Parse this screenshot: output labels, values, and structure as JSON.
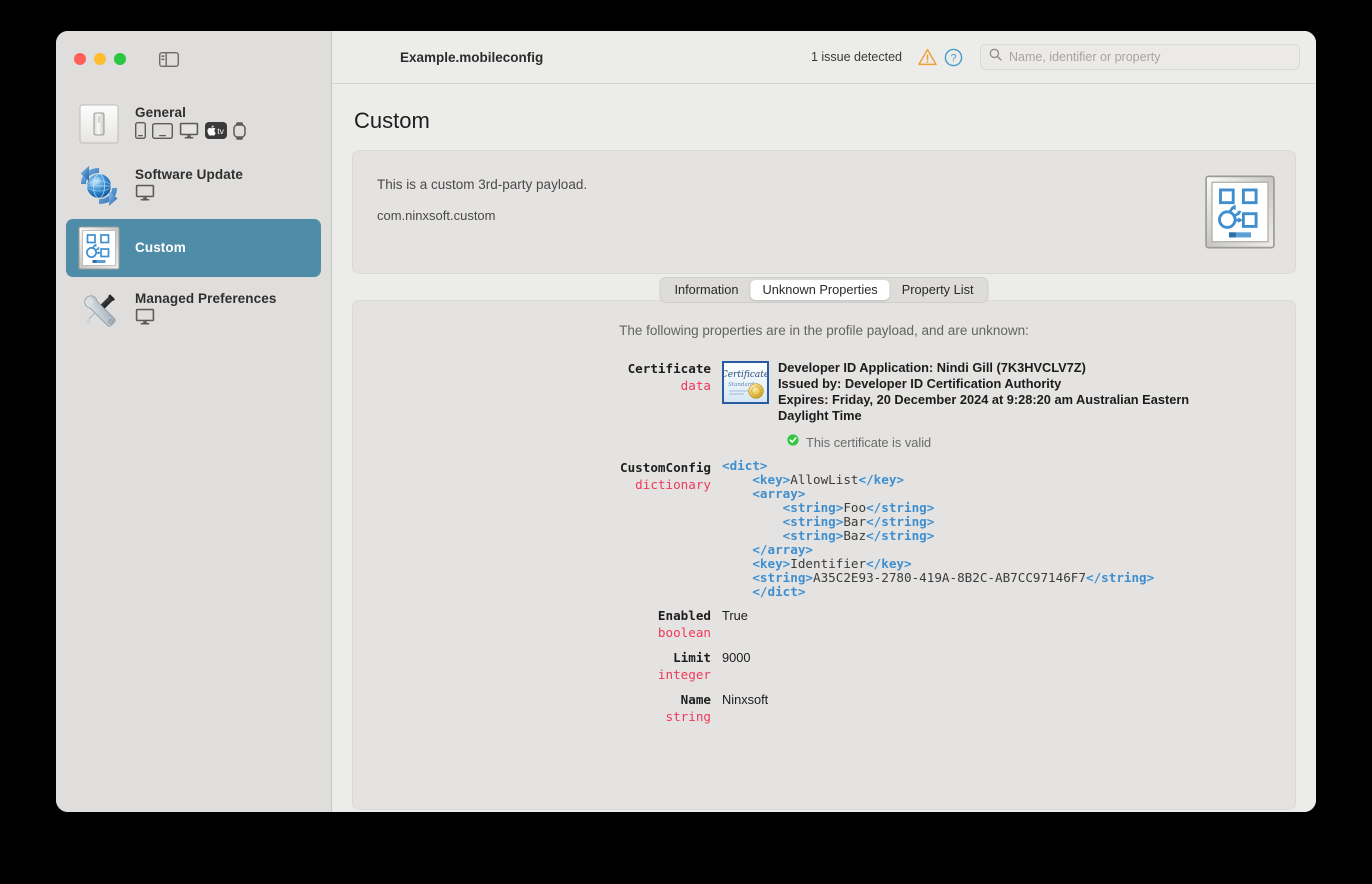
{
  "window": {
    "traffic_lights": [
      "close",
      "minimize",
      "zoom"
    ],
    "sidebar_toggle_icon": "sidebar-toggle-icon"
  },
  "toolbar": {
    "document_title": "Example.mobileconfig",
    "issue_text": "1 issue detected",
    "warning_icon": "warning-triangle-icon",
    "help_icon": "help-circle-icon",
    "search": {
      "icon": "search-icon",
      "placeholder": "Name, identifier or property",
      "value": ""
    }
  },
  "sidebar": {
    "items": [
      {
        "label": "General",
        "icon": "general-switch-icon",
        "platforms": [
          "iphone",
          "ipad",
          "mac",
          "appletv",
          "applewatch"
        ],
        "selected": false
      },
      {
        "label": "Software Update",
        "icon": "software-update-icon",
        "platforms": [
          "mac"
        ],
        "selected": false
      },
      {
        "label": "Custom",
        "icon": "custom-payload-icon",
        "platforms": [],
        "selected": true
      },
      {
        "label": "Managed Preferences",
        "icon": "managed-preferences-icon",
        "platforms": [
          "mac"
        ],
        "selected": false
      }
    ]
  },
  "page": {
    "title": "Custom",
    "description_line1": "This is a custom 3rd-party payload.",
    "description_line2": "com.ninxsoft.custom",
    "description_icon": "custom-payload-icon"
  },
  "tabs": [
    {
      "label": "Information",
      "active": false
    },
    {
      "label": "Unknown Properties",
      "active": true
    },
    {
      "label": "Property List",
      "active": false
    }
  ],
  "unknown_properties": {
    "intro": "The following properties are in the profile payload, and are unknown:",
    "rows": [
      {
        "key": "Certificate",
        "type": "data",
        "kind": "certificate",
        "thumb_icon": "certificate-icon",
        "subject": "Developer ID Application: Nindi Gill (7K3HVCLV7Z)",
        "issuer": "Issued by: Developer ID Certification Authority",
        "expires": "Expires: Friday, 20 December 2024 at 9:28:20 am Australian Eastern Daylight Time",
        "validity_icon": "valid-check-icon",
        "validity_text": "This certificate is valid"
      },
      {
        "key": "CustomConfig",
        "type": "dictionary",
        "kind": "xml",
        "xml_lines": [
          [
            {
              "t": "tag",
              "s": "<dict>"
            }
          ],
          [
            {
              "t": "pt",
              "s": "    "
            },
            {
              "t": "tag",
              "s": "<key>"
            },
            {
              "t": "pt",
              "s": "AllowList"
            },
            {
              "t": "tag",
              "s": "</key>"
            }
          ],
          [
            {
              "t": "pt",
              "s": "    "
            },
            {
              "t": "tag",
              "s": "<array>"
            }
          ],
          [
            {
              "t": "pt",
              "s": "        "
            },
            {
              "t": "tag",
              "s": "<string>"
            },
            {
              "t": "pt",
              "s": "Foo"
            },
            {
              "t": "tag",
              "s": "</string>"
            }
          ],
          [
            {
              "t": "pt",
              "s": "        "
            },
            {
              "t": "tag",
              "s": "<string>"
            },
            {
              "t": "pt",
              "s": "Bar"
            },
            {
              "t": "tag",
              "s": "</string>"
            }
          ],
          [
            {
              "t": "pt",
              "s": "        "
            },
            {
              "t": "tag",
              "s": "<string>"
            },
            {
              "t": "pt",
              "s": "Baz"
            },
            {
              "t": "tag",
              "s": "</string>"
            }
          ],
          [
            {
              "t": "pt",
              "s": "    "
            },
            {
              "t": "tag",
              "s": "</array>"
            }
          ],
          [
            {
              "t": "pt",
              "s": "    "
            },
            {
              "t": "tag",
              "s": "<key>"
            },
            {
              "t": "pt",
              "s": "Identifier"
            },
            {
              "t": "tag",
              "s": "</key>"
            }
          ],
          [
            {
              "t": "pt",
              "s": "    "
            },
            {
              "t": "tag",
              "s": "<string>"
            },
            {
              "t": "pt",
              "s": "A35C2E93-2780-419A-8B2C-AB7CC97146F7"
            },
            {
              "t": "tag",
              "s": "</string>"
            }
          ],
          [
            {
              "t": "pt",
              "s": "    "
            },
            {
              "t": "tag",
              "s": "</dict>"
            }
          ]
        ]
      },
      {
        "key": "Enabled",
        "type": "boolean",
        "kind": "plain",
        "value": "True"
      },
      {
        "key": "Limit",
        "type": "integer",
        "kind": "plain",
        "value": "9000"
      },
      {
        "key": "Name",
        "type": "string",
        "kind": "plain",
        "value": "Ninxsoft"
      }
    ]
  },
  "colors": {
    "accent_selected": "#4e8ca8",
    "window_bg": "#ececea",
    "sidebar_bg": "#dfdedc",
    "card_bg": "#e4e3e1",
    "type_red": "#f0385a",
    "xml_blue": "#3f8fd0",
    "warning_orange": "#f0a03c",
    "help_blue": "#4a9cc8",
    "valid_green": "#33c642"
  }
}
